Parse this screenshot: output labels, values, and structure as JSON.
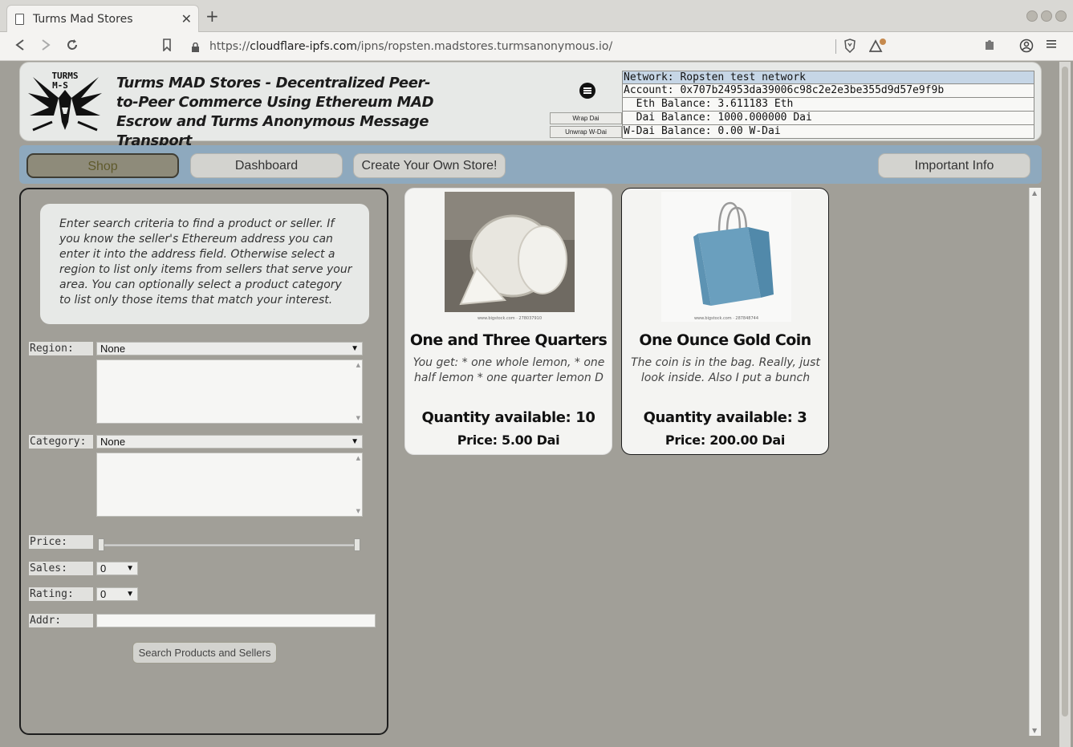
{
  "browser": {
    "tab_title": "Turms Mad Stores",
    "url_prefix": "https://",
    "url_host": "cloudflare-ipfs.com",
    "url_path": "/ipns/ropsten.madstores.turmsanonymous.io/"
  },
  "header": {
    "logo_text": "TURMS M-S",
    "title": "Turms MAD Stores - Decentralized Peer-to-Peer Commerce Using Ethereum MAD Escrow and Turms Anonymous Message Transport",
    "wrap_label": "Wrap Dai",
    "unwrap_label": "Unwrap W-Dai",
    "network": "Network: Ropsten test network",
    "account": "Account: 0x707b24953da39006c98c2e2e3be355d9d57e9f9b",
    "eth_balance": "  Eth Balance: 3.611183 Eth",
    "dai_balance": "  Dai Balance: 1000.000000 Dai",
    "wdai_balance": "W-Dai Balance: 0.00 W-Dai"
  },
  "menu": {
    "shop": "Shop",
    "dashboard": "Dashboard",
    "create_store": "Create Your Own Store!",
    "important_info": "Important Info"
  },
  "search": {
    "help_text": "Enter search criteria to find a product or seller. If you know the seller's Ethereum address you can enter it into the address field. Otherwise select a region to list only items from sellers that serve your area. You can optionally select a product category to list only those items that match your interest.",
    "region_label": "Region:",
    "region_value": "None",
    "category_label": "Category:",
    "category_value": "None",
    "price_label": "Price:",
    "sales_label": "Sales:",
    "sales_value": "0",
    "rating_label": "Rating:",
    "rating_value": "0",
    "addr_label": "Addr:",
    "addr_value": "",
    "search_button": "Search Products and Sellers"
  },
  "products": [
    {
      "title": "One and Three Quarters",
      "description": "You get: * one whole lemon, * one half lemon * one quarter lemon D",
      "quantity": "Quantity available: 10",
      "price": "Price: 5.00 Dai",
      "image_caption": "www.bigstock.com · 278037910"
    },
    {
      "title": "One Ounce Gold Coin",
      "description": "The coin is in the bag. Really, just look inside. Also I put a bunch",
      "quantity": "Quantity available: 3",
      "price": "Price: 200.00 Dai",
      "image_caption": "www.bigstock.com · 287848744"
    }
  ],
  "icons": {
    "tab": "page-icon",
    "close": "close-icon",
    "new_tab": "plus-icon",
    "back": "back-icon",
    "forward": "forward-icon",
    "reload": "reload-icon",
    "bookmark": "bookmark-icon",
    "lock": "lock-icon",
    "brave": "shield-icon",
    "rewards": "triangle-icon",
    "extension": "puzzle-icon",
    "profile": "profile-icon",
    "menu": "hamburger-icon"
  }
}
